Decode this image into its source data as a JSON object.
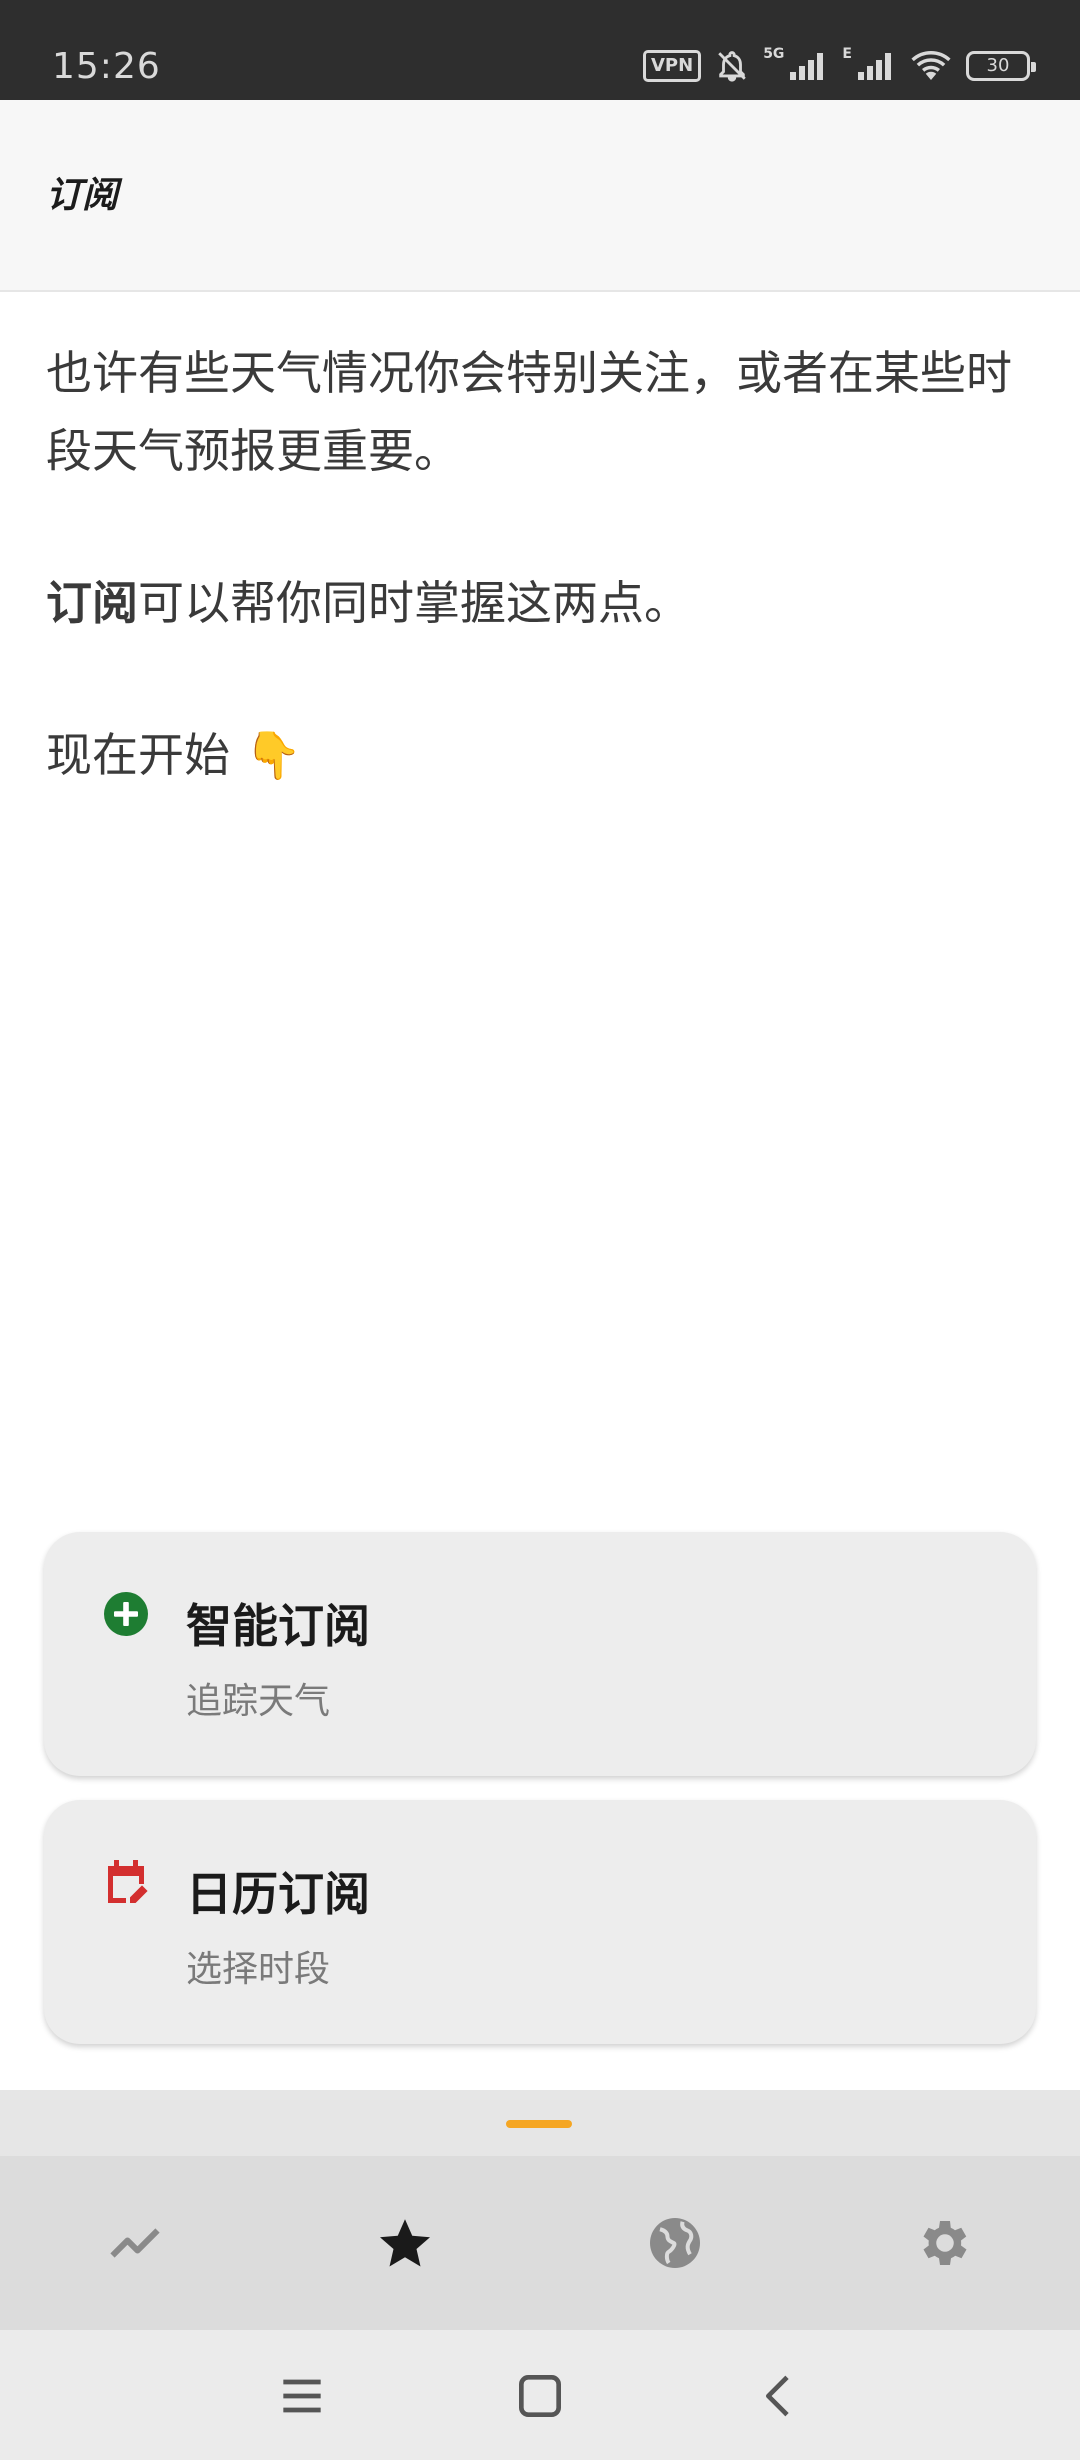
{
  "status_bar": {
    "time": "15:26",
    "vpn": "VPN",
    "net1": "5G",
    "net2": "E",
    "battery": "30",
    "icons": [
      "vpn-icon",
      "bell-off-icon",
      "signal-icon",
      "signal-icon",
      "wifi-icon",
      "battery-icon"
    ]
  },
  "app_bar": {
    "title": "订阅"
  },
  "intro": {
    "line1": "也许有些天气情况你会特别关注，或者在某些时段天气预报更重要。",
    "line2_bold": "订阅",
    "line2_rest": "可以帮你同时掌握这两点。",
    "line3": "现在开始 👇"
  },
  "cards": [
    {
      "title": "智能订阅",
      "subtitle": "追踪天气",
      "icon": "add-circle-icon",
      "icon_color": "#1e7d32"
    },
    {
      "title": "日历订阅",
      "subtitle": "选择时段",
      "icon": "calendar-edit-icon",
      "icon_color": "#d32f2f"
    }
  ],
  "handle_color": "#f5a623",
  "bottom_nav": {
    "items": [
      {
        "icon": "trend-icon",
        "active": false
      },
      {
        "icon": "star-icon",
        "active": true
      },
      {
        "icon": "globe-icon",
        "active": false
      },
      {
        "icon": "gear-icon",
        "active": false
      }
    ]
  },
  "system_nav": {
    "icons": [
      "menu-icon",
      "home-icon",
      "back-icon"
    ]
  }
}
